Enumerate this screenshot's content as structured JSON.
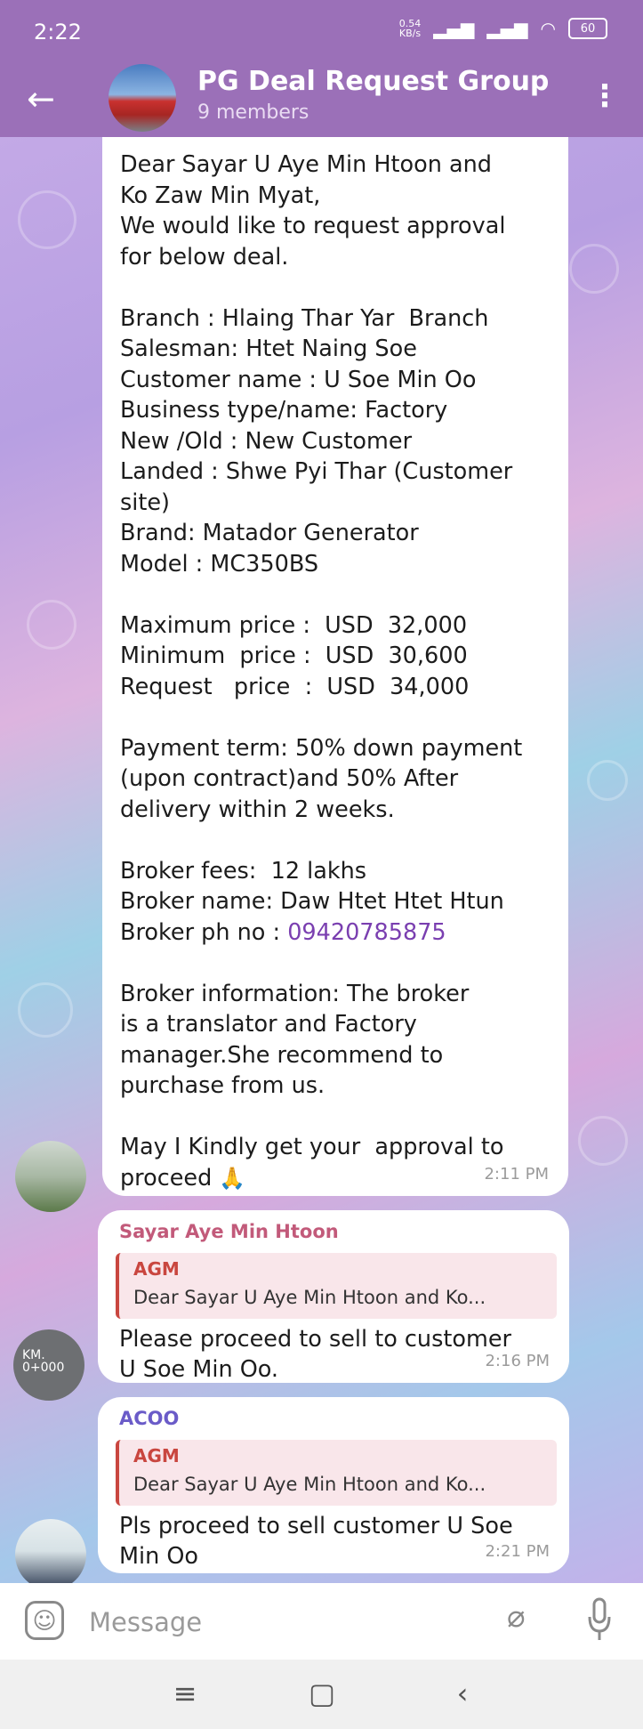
{
  "status_bar": {
    "time": "2:22",
    "speed_value": "0.54",
    "speed_unit": "KB/s",
    "battery": "60"
  },
  "header": {
    "title": "PG Deal Request Group",
    "subtitle": "9 members"
  },
  "messages": [
    {
      "text_before_phone": "Dear Sayar U Aye Min Htoon and\nKo Zaw Min Myat,\nWe would like to request approval\nfor below deal.\n\nBranch : Hlaing Thar Yar  Branch\nSalesman: Htet Naing Soe\nCustomer name : U Soe Min Oo\nBusiness type/name: Factory\nNew /Old : New Customer\nLanded : Shwe Pyi Thar (Customer\nsite)\nBrand: Matador Generator\nModel : MC350BS\n\nMaximum price :  USD  32,000\nMinimum  price :  USD  30,600\nRequest   price  :  USD  34,000\n\nPayment term: 50% down payment\n(upon contract)and 50% After\ndelivery within 2 weeks.\n\nBroker fees:  12 lakhs\nBroker name: Daw Htet Htet Htun\nBroker ph no : ",
      "phone": "09420785875",
      "text_after_phone": "\n\nBroker information: The broker\nis a translator and Factory\nmanager.She recommend to\npurchase from us.\n\nMay I Kindly get your  approval to\nproceed ",
      "emoji": "🙏",
      "time": "2:11 PM"
    },
    {
      "sender": "Sayar Aye Min Htoon",
      "reply_author": "AGM",
      "reply_text": "Dear Sayar U Aye Min Htoon and Ko...",
      "text": "Please proceed to sell to customer\nU Soe Min Oo.",
      "time": "2:16 PM"
    },
    {
      "sender": "ACOO",
      "reply_author": "AGM",
      "reply_text": "Dear Sayar U Aye Min Htoon and Ko...",
      "text": "Pls proceed to sell customer U Soe\nMin Oo",
      "time": "2:21 PM"
    }
  ],
  "avatar_2_text": "KM.\n0+000",
  "input": {
    "placeholder": "Message"
  },
  "icons": {
    "back": "arrow-left",
    "menu": "more-vertical",
    "sticker": "sticker",
    "attach": "paperclip",
    "mic": "microphone"
  },
  "colors": {
    "header": "#9b70b8",
    "link": "#7a3fb0",
    "reply_accent": "#c9463f"
  }
}
